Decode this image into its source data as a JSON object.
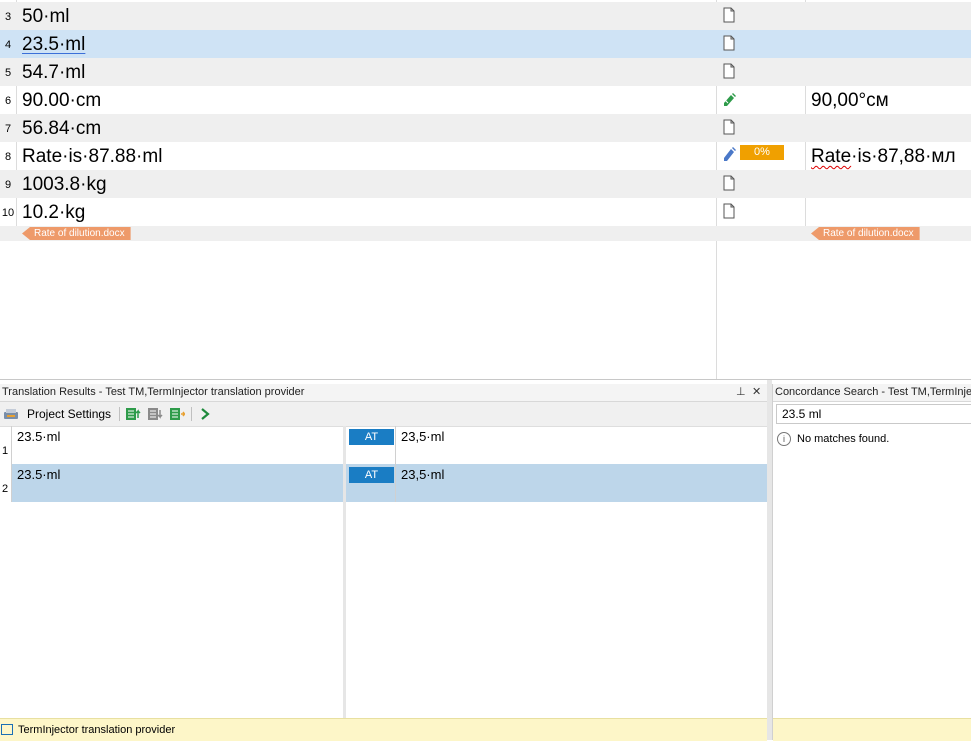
{
  "editor": {
    "rows": [
      {
        "num": "3",
        "source": "50·ml",
        "status": "doc",
        "target": ""
      },
      {
        "num": "4",
        "source": "23.5·ml",
        "status": "doc",
        "target": ""
      },
      {
        "num": "5",
        "source": "54.7·ml",
        "status": "doc",
        "target": ""
      },
      {
        "num": "6",
        "source": "90.00·cm",
        "status": "translated",
        "target": "90,00°см"
      },
      {
        "num": "7",
        "source": "56.84·cm",
        "status": "doc",
        "target": ""
      },
      {
        "num": "8",
        "source": "Rate·is·87.88·ml",
        "status": "draft",
        "match": "0%",
        "target_a": "Rate",
        "target_b": "·is·87,88·мл"
      },
      {
        "num": "9",
        "source": "1003.8·kg",
        "status": "doc",
        "target": ""
      },
      {
        "num": "10",
        "source": "10.2·kg",
        "status": "doc",
        "target": ""
      }
    ],
    "file_tag_source": "Rate of dilution.docx",
    "file_tag_target": "Rate of dilution.docx"
  },
  "translation_results": {
    "title": "Translation Results - Test TM,TermInjector translation provider",
    "pin_glyph": "⊥",
    "close_glyph": "✕",
    "toolbar": {
      "project_settings": "Project Settings"
    },
    "rows": [
      {
        "num": "1",
        "source": "23.5·ml",
        "badge": "AT",
        "target": "23,5·ml"
      },
      {
        "num": "2",
        "source": "23.5·ml",
        "badge": "AT",
        "target": "23,5·ml"
      }
    ],
    "status": "TermInjector translation provider"
  },
  "concordance": {
    "title": "Concordance Search - Test TM,TermInjector",
    "query": "23.5 ml",
    "message": "No matches found.",
    "info_glyph": "i"
  },
  "colors": {
    "selected_row": "#cfe3f5",
    "alt_row": "#efefef",
    "match_badge": "#f0a000",
    "at_badge": "#1a7dc4",
    "file_tag": "#ee9a6a",
    "status_bar": "#fdf6c8"
  }
}
